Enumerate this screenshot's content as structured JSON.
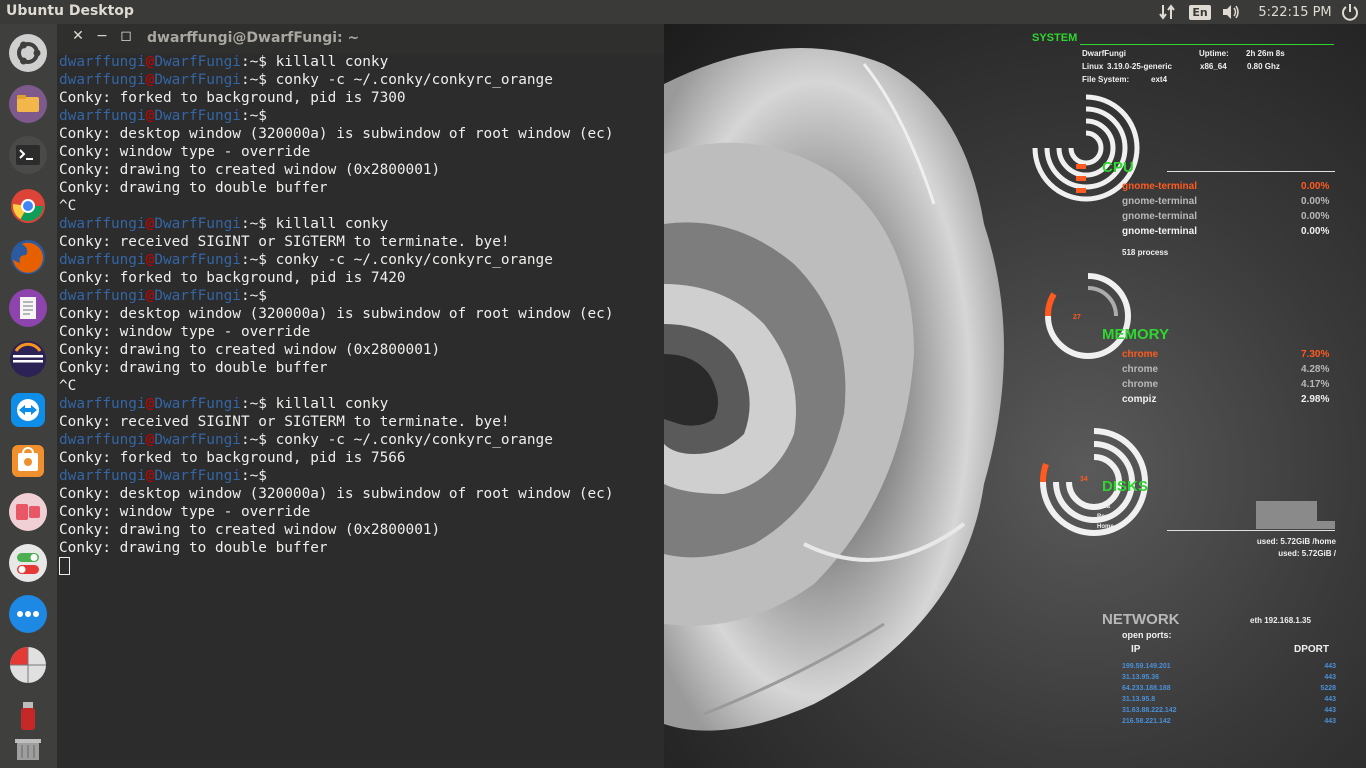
{
  "top_panel": {
    "title": "Ubuntu Desktop",
    "language": "En",
    "clock": "5:22:15 PM",
    "icons": [
      "network-icon",
      "volume-icon",
      "power-icon"
    ]
  },
  "launcher": {
    "items": [
      {
        "name": "ubuntu-dash",
        "color": "#d9d9d9"
      },
      {
        "name": "files",
        "color": "#f2b64b"
      },
      {
        "name": "terminal",
        "color": "#2c2c2c"
      },
      {
        "name": "chrome",
        "color": "#4285f4"
      },
      {
        "name": "firefox",
        "color": "#e66000"
      },
      {
        "name": "text-editor",
        "color": "#8e44ad"
      },
      {
        "name": "eclipse",
        "color": "#2c2255"
      },
      {
        "name": "teamviewer",
        "color": "#0e8ee9"
      },
      {
        "name": "software-center",
        "color": "#f08f2e"
      },
      {
        "name": "unity-tweak",
        "color": "#e95666"
      },
      {
        "name": "settings-toggle",
        "color": "#e8e8e8"
      },
      {
        "name": "more-apps",
        "color": "#1e88e5"
      },
      {
        "name": "disk-usage",
        "color": "#e0e0e0"
      },
      {
        "name": "usb-drive",
        "color": "#c62828"
      },
      {
        "name": "trash",
        "color": "#9e9e9e"
      }
    ]
  },
  "terminal": {
    "title": "dwarffungi@DwarfFungi: ~",
    "prompt": {
      "user": "dwarffungi",
      "at": "@",
      "host": "DwarfFungi",
      "dir": ":~$"
    },
    "lines": [
      {
        "prompt": true,
        "text": " killall conky"
      },
      {
        "prompt": true,
        "text": " conky -c ~/.conky/conkyrc_orange"
      },
      {
        "prompt": false,
        "text": "Conky: forked to background, pid is 7300"
      },
      {
        "prompt": true,
        "text": ""
      },
      {
        "prompt": false,
        "text": "Conky: desktop window (320000a) is subwindow of root window (ec)"
      },
      {
        "prompt": false,
        "text": "Conky: window type - override"
      },
      {
        "prompt": false,
        "text": "Conky: drawing to created window (0x2800001)"
      },
      {
        "prompt": false,
        "text": "Conky: drawing to double buffer"
      },
      {
        "prompt": false,
        "text": "^C"
      },
      {
        "prompt": true,
        "text": " killall conky"
      },
      {
        "prompt": false,
        "text": "Conky: received SIGINT or SIGTERM to terminate. bye!"
      },
      {
        "prompt": true,
        "text": " conky -c ~/.conky/conkyrc_orange"
      },
      {
        "prompt": false,
        "text": "Conky: forked to background, pid is 7420"
      },
      {
        "prompt": true,
        "text": ""
      },
      {
        "prompt": false,
        "text": "Conky: desktop window (320000a) is subwindow of root window (ec)"
      },
      {
        "prompt": false,
        "text": "Conky: window type - override"
      },
      {
        "prompt": false,
        "text": "Conky: drawing to created window (0x2800001)"
      },
      {
        "prompt": false,
        "text": "Conky: drawing to double buffer"
      },
      {
        "prompt": false,
        "text": "^C"
      },
      {
        "prompt": true,
        "text": " killall conky"
      },
      {
        "prompt": false,
        "text": "Conky: received SIGINT or SIGTERM to terminate. bye!"
      },
      {
        "prompt": true,
        "text": " conky -c ~/.conky/conkyrc_orange"
      },
      {
        "prompt": false,
        "text": "Conky: forked to background, pid is 7566"
      },
      {
        "prompt": true,
        "text": ""
      },
      {
        "prompt": false,
        "text": "Conky: desktop window (320000a) is subwindow of root window (ec)"
      },
      {
        "prompt": false,
        "text": "Conky: window type - override"
      },
      {
        "prompt": false,
        "text": "Conky: drawing to created window (0x2800001)"
      },
      {
        "prompt": false,
        "text": "Conky: drawing to double buffer"
      }
    ]
  },
  "conky": {
    "system": {
      "heading": "SYSTEM",
      "hostname": "DwarfFungi",
      "uptime_label": "Uptime:",
      "uptime": "2h 26m 8s",
      "os": "Linux",
      "kernel": "3.19.0-25-generic",
      "arch": "x86_64",
      "freq": "0.80 Ghz",
      "fs_label": "File System:",
      "fs": "ext4"
    },
    "cpu": {
      "heading": "CPU",
      "processes": [
        {
          "name": "gnome-terminal",
          "value": "0.00%"
        },
        {
          "name": "gnome-terminal",
          "value": "0.00%"
        },
        {
          "name": "gnome-terminal",
          "value": "0.00%"
        },
        {
          "name": "gnome-terminal",
          "value": "0.00%"
        }
      ],
      "process_count": "518 process"
    },
    "memory": {
      "heading": "MEMORY",
      "ring_label": "27",
      "processes": [
        {
          "name": "chrome",
          "value": "7.30%"
        },
        {
          "name": "chrome",
          "value": "4.28%"
        },
        {
          "name": "chrome",
          "value": "4.17%"
        },
        {
          "name": "compiz",
          "value": "2.98%"
        }
      ]
    },
    "disks": {
      "heading": "DISKS",
      "ring_label": "34",
      "ring_legend": [
        "Data",
        "Root",
        "Home"
      ],
      "used_home": "used: 5.72GiB /home",
      "used_root": "used: 5.72GiB /"
    },
    "network": {
      "heading": "NETWORK",
      "iface": "eth 192.168.1.35",
      "open_ports_label": "open ports:",
      "col_ip": "IP",
      "col_dport": "DPORT",
      "rows": [
        {
          "ip": "199.59.149.201",
          "port": "443"
        },
        {
          "ip": "31.13.95.36",
          "port": "443"
        },
        {
          "ip": "64.233.188.188",
          "port": "5228"
        },
        {
          "ip": "31.13.95.8",
          "port": "443"
        },
        {
          "ip": "31.63.88.222.142",
          "port": "443"
        },
        {
          "ip": "216.58.221.142",
          "port": "443"
        }
      ]
    },
    "colors": {
      "accent": "#2fd62f",
      "alert": "#ff5a1f",
      "text": "#f0f0f0",
      "link": "#4a8fd6"
    }
  }
}
